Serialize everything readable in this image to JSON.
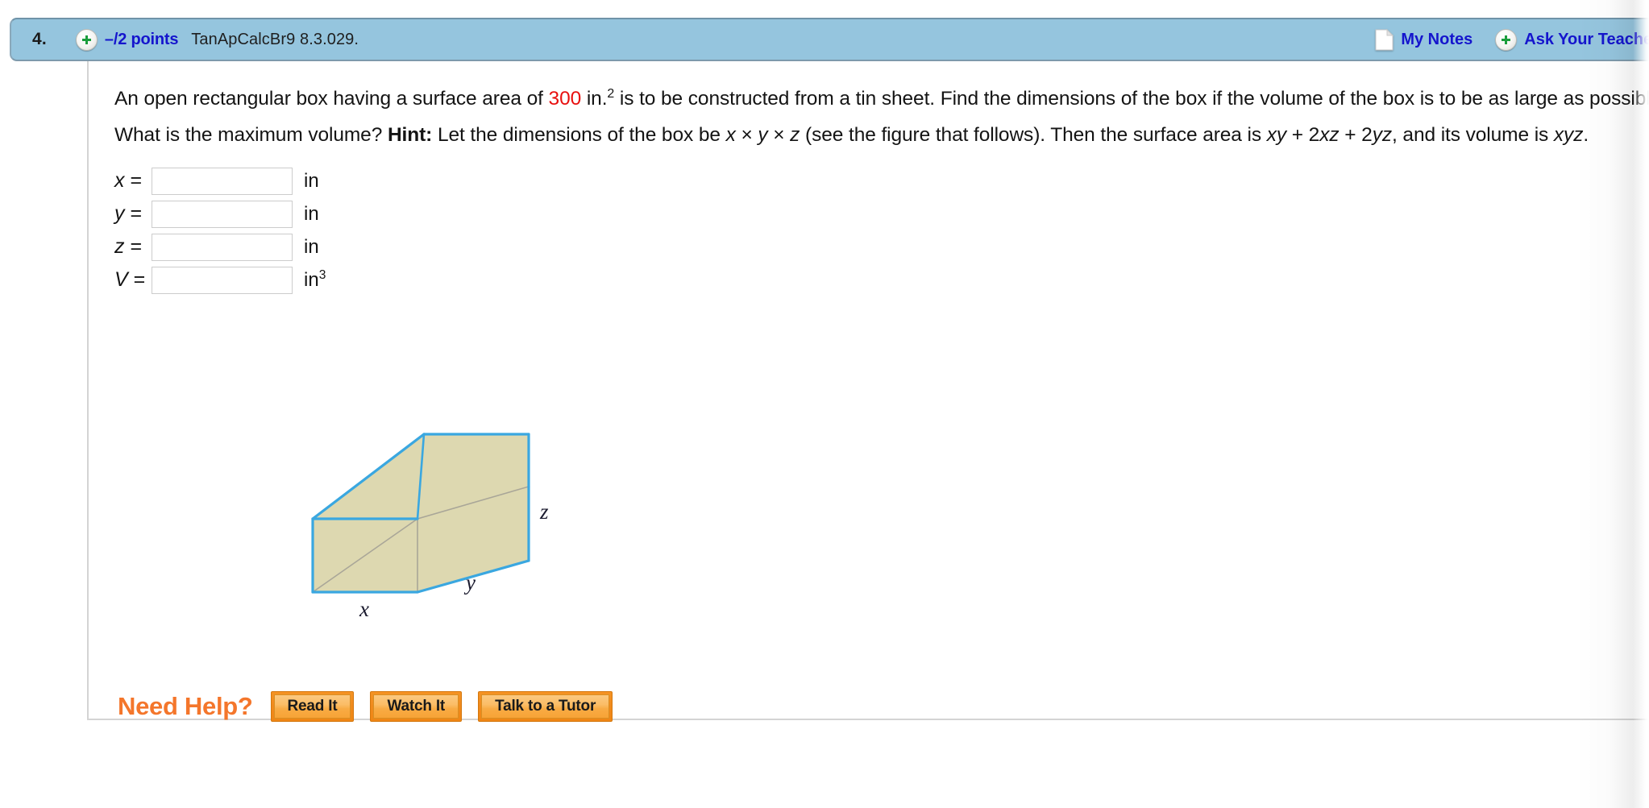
{
  "header": {
    "question_number": "4.",
    "plus_icon": "plus-circle-icon",
    "points": "–/2 points",
    "assignment_code": "TanApCalcBr9 8.3.029.",
    "notes_icon": "document-page-icon",
    "my_notes_label": "My Notes",
    "ask_plus_icon": "plus-circle-icon",
    "ask_teacher_label": "Ask Your Teacher",
    "bar_color": "#95c5de",
    "link_color": "#1515cd"
  },
  "question": {
    "line1_a": "An open rectangular box having a surface area of ",
    "line1_value": "300",
    "line1_b": " in.",
    "line1_sup": "2",
    "line1_c": " is to be constructed from a tin sheet. Find the dimensions of the box if the volume of the box is to be as large as possible. What is the maximum volume? ",
    "hint_label": "Hint:",
    "line2_a": " Let the dimensions of the box be ",
    "var_x": "x",
    "times1": " × ",
    "var_y": "y",
    "times2": " × ",
    "var_z": "z",
    "line3_a": " (see the figure that follows). Then the surface area is  ",
    "surface_area_x": "x",
    "surface_area_y": "y",
    "surface_area_plus1": " + 2",
    "surface_area_xz": "xz",
    "surface_area_plus2": " + 2",
    "surface_area_yz": "yz",
    "surface_area_end": ",  and its volume is ",
    "volume_expr": "xyz",
    "period": ".",
    "highlight_color": "#e8100f"
  },
  "answers": [
    {
      "label": "x",
      "equals": " =",
      "value": "",
      "placeholder": "",
      "unit": "in",
      "unit_sup": ""
    },
    {
      "label": "y",
      "equals": " =",
      "value": "",
      "placeholder": "",
      "unit": "in",
      "unit_sup": ""
    },
    {
      "label": "z",
      "equals": " =",
      "value": "",
      "placeholder": "",
      "unit": "in",
      "unit_sup": ""
    },
    {
      "label": "V",
      "equals": " =",
      "value": "",
      "placeholder": "",
      "unit": "in",
      "unit_sup": "3"
    }
  ],
  "figure": {
    "name": "open-rectangular-box-diagram",
    "fill_color": "#ddd8b0",
    "edge_color": "#3aa7e0",
    "hidden_edge_color": "#a9a698",
    "label_x": "x",
    "label_y": "y",
    "label_z": "z"
  },
  "need_help": {
    "label": "Need Help?",
    "label_color": "#f4762b",
    "buttons": [
      {
        "name": "read-it-button",
        "label": "Read It"
      },
      {
        "name": "watch-it-button",
        "label": "Watch It"
      },
      {
        "name": "talk-to-a-tutor-button",
        "label": "Talk to a Tutor"
      }
    ]
  }
}
